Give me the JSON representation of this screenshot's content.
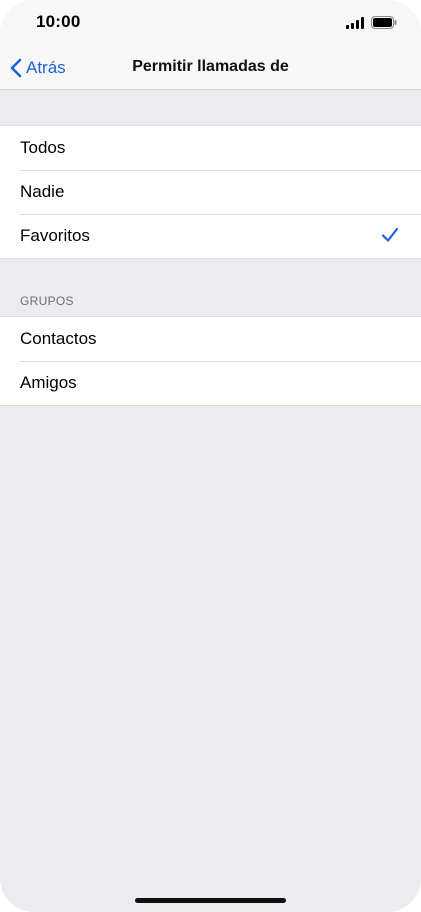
{
  "status_bar": {
    "time": "10:00",
    "icons": [
      "signal-icon",
      "battery-icon"
    ]
  },
  "nav": {
    "back_label": "Atrás",
    "title": "Permitir llamadas de",
    "back_icon": "chevron-left-icon"
  },
  "options": [
    {
      "label": "Todos",
      "selected": false
    },
    {
      "label": "Nadie",
      "selected": false
    },
    {
      "label": "Favoritos",
      "selected": true
    }
  ],
  "groups_section": {
    "header": "GRUPOS",
    "items": [
      {
        "label": "Contactos"
      },
      {
        "label": "Amigos"
      }
    ]
  },
  "colors": {
    "accent": "#1c63d6",
    "background": "#ebebf0",
    "cell": "#ffffff"
  }
}
